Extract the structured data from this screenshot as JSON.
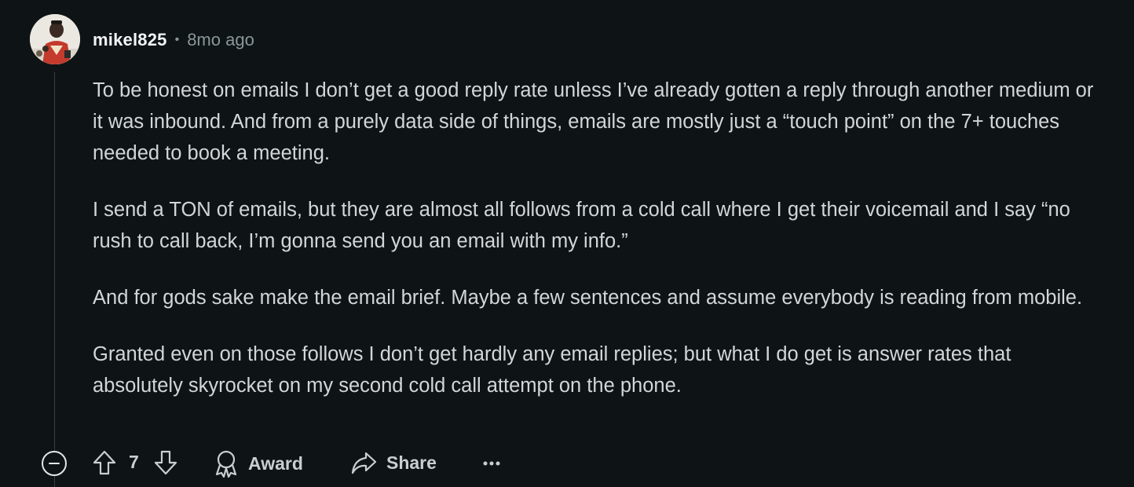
{
  "comment": {
    "username": "mikel825",
    "separator": "•",
    "timestamp": "8mo ago",
    "paragraphs": [
      "To be honest on emails I don’t get a good reply rate unless I’ve already gotten a reply through another medium or it was inbound. And from a purely data side of things, emails are mostly just a “touch point” on the 7+ touches needed to book a meeting.",
      "I send a TON of emails, but they are almost all follows from a cold call where I get their voicemail and I say “no rush to call back, I’m gonna send you an email with my info.”",
      "And for gods sake make the email brief. Maybe a few sentences and assume everybody is reading from mobile.",
      "Granted even on those follows I don’t get hardly any email replies; but what I do get is answer rates that absolutely skyrocket on my second cold call attempt on the phone."
    ]
  },
  "actions": {
    "score": "7",
    "award_label": "Award",
    "share_label": "Share",
    "more_label": "···"
  },
  "icons": {
    "collapse": "minus-circle-icon",
    "upvote": "arrow-up-icon",
    "downvote": "arrow-down-icon",
    "award": "award-icon",
    "share": "share-icon",
    "more": "ellipsis-icon"
  },
  "colors": {
    "background": "#0e1416",
    "text": "#d3d6d8",
    "muted": "#8b969b",
    "username": "#f2f4f5"
  }
}
